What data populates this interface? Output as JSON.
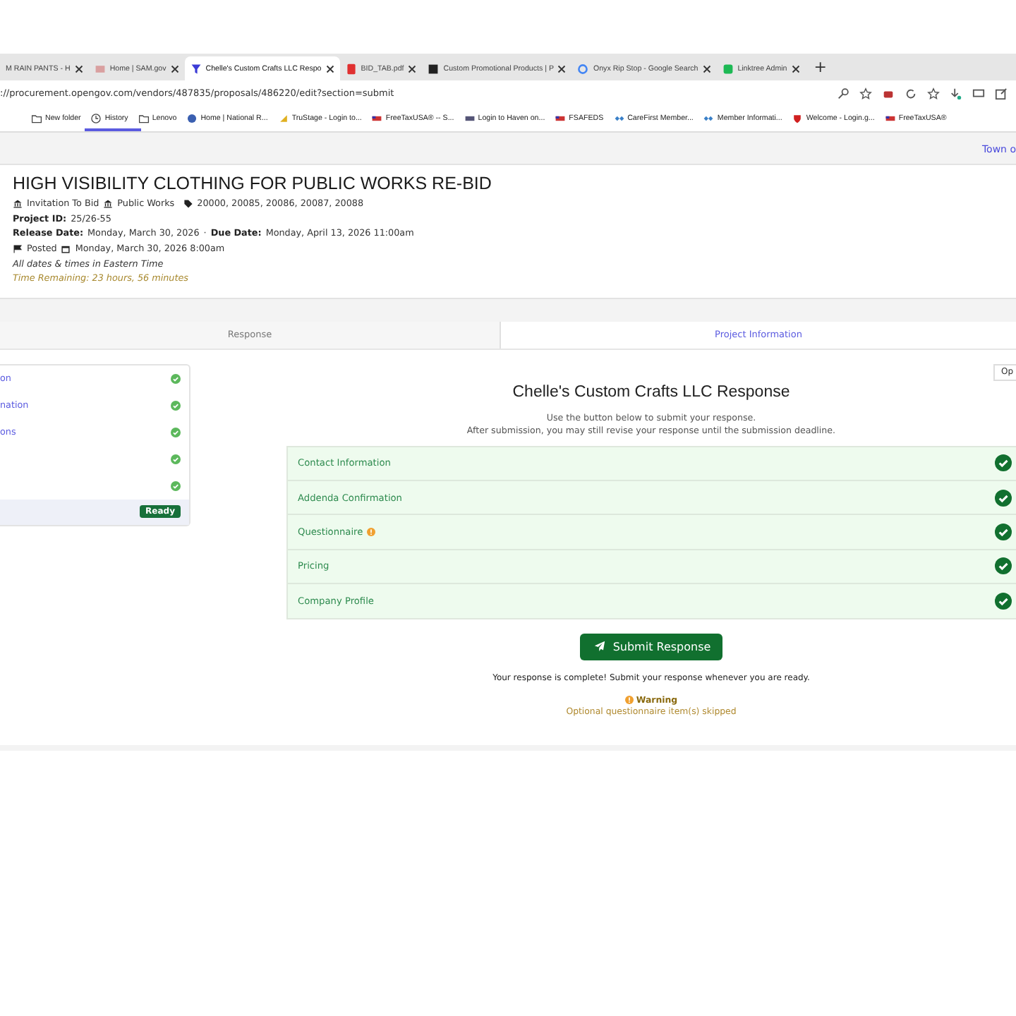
{
  "browser": {
    "tabs": [
      {
        "title": "M RAIN PANTS - H",
        "selected": false
      },
      {
        "title": "Home | SAM.gov",
        "selected": false
      },
      {
        "title": "Chelle's Custom Crafts LLC Respo",
        "selected": true
      },
      {
        "title": "BID_TAB.pdf",
        "selected": false
      },
      {
        "title": "Custom Promotional Products | P",
        "selected": false
      },
      {
        "title": "Onyx Rip Stop - Google Search",
        "selected": false
      },
      {
        "title": "Linktree Admin",
        "selected": false
      }
    ],
    "new_tab": "+",
    "url": "://procurement.opengov.com/vendors/487835/proposals/486220/edit?section=submit",
    "bookmarks": [
      {
        "label": "New folder"
      },
      {
        "label": "History"
      },
      {
        "label": "Lenovo"
      },
      {
        "label": "Home | National R..."
      },
      {
        "label": "TruStage - Login to..."
      },
      {
        "label": "FreeTaxUSA® -- S..."
      },
      {
        "label": "Login to Haven on..."
      },
      {
        "label": "FSAFEDS"
      },
      {
        "label": "CareFirst Member..."
      },
      {
        "label": "Member Informati..."
      },
      {
        "label": "Welcome - Login.g..."
      },
      {
        "label": "FreeTaxUSA®"
      }
    ]
  },
  "page": {
    "top_link": "Town o",
    "project": {
      "title": "HIGH VISIBILITY CLOTHING FOR PUBLIC WORKS RE-BID",
      "type": "Invitation To Bid",
      "department": "Public Works",
      "codes": "20000, 20085, 20086, 20087, 20088",
      "id_label": "Project ID:",
      "id": "25/26-55",
      "release_label": "Release Date:",
      "release": "Monday, March 30, 2026",
      "separator": "·",
      "due_label": "Due Date:",
      "due": "Monday, April 13, 2026 11:00am",
      "status": "Posted",
      "posted": "Monday, March 30, 2026 8:00am",
      "timezone": "All dates & times in Eastern Time",
      "remaining": "Time Remaining: 23 hours, 56 minutes"
    },
    "tabs": [
      {
        "label": "Response",
        "selected": true
      },
      {
        "label": "Project Information",
        "selected": false
      }
    ],
    "sidebar": {
      "items": [
        {
          "label": "on",
          "complete": true
        },
        {
          "label": "nation",
          "complete": true
        },
        {
          "label": "ons",
          "complete": true
        },
        {
          "complete": true
        },
        {
          "complete": true
        }
      ],
      "status": "Ready"
    },
    "options_button": "Op",
    "heading": "Chelle's Custom Crafts LLC Response",
    "instructions": [
      "Use the button below to submit your response.",
      "After submission, you may still revise your response until the submission deadline."
    ],
    "sections": [
      {
        "label": "Contact Information",
        "warning": false,
        "complete": true
      },
      {
        "label": "Addenda Confirmation",
        "warning": false,
        "complete": true
      },
      {
        "label": "Questionnaire",
        "warning": true,
        "complete": true
      },
      {
        "label": "Pricing",
        "warning": false,
        "complete": true
      },
      {
        "label": "Company Profile",
        "warning": false,
        "complete": true
      }
    ],
    "submit": "Submit Response",
    "message": "Your response is complete! Submit your response whenever you are ready.",
    "warning_title": "Warning",
    "warning_text": "Optional questionnaire item(s) skipped"
  }
}
